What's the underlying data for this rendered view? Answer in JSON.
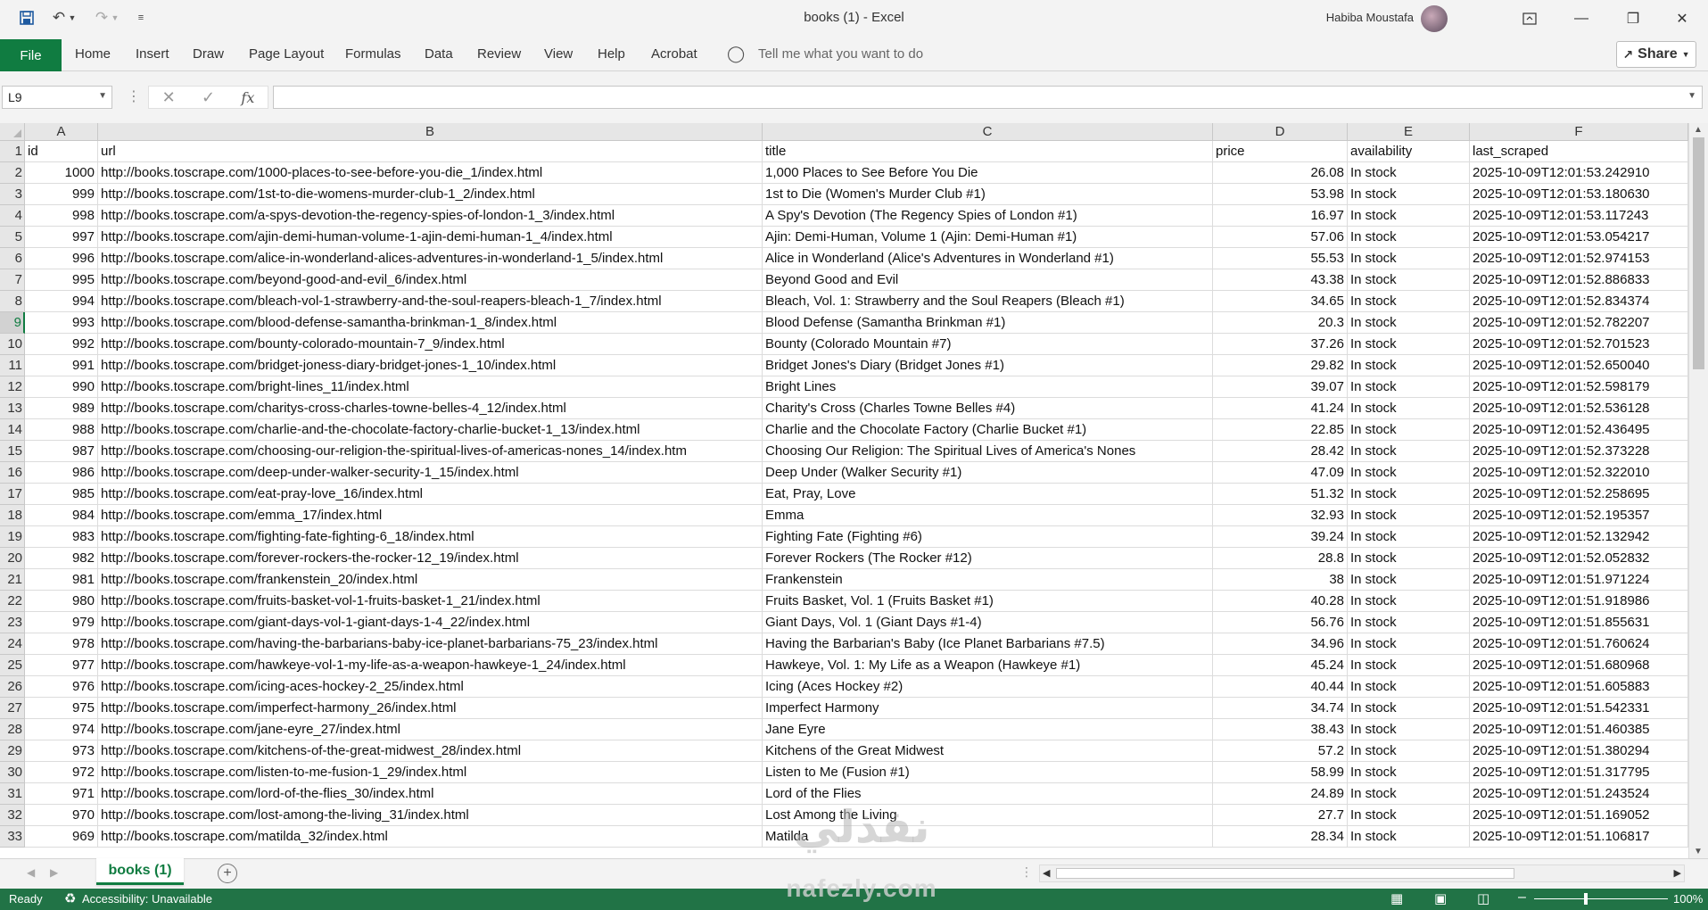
{
  "window": {
    "title": "books (1)  -  Excel",
    "user_name": "Habiba Moustafa"
  },
  "quick_access": {
    "save_icon": "save-icon",
    "undo_icon": "undo-icon",
    "redo_icon": "redo-icon",
    "customize_icon": "customize-icon"
  },
  "ribbon": {
    "file": "File",
    "tabs": [
      "Home",
      "Insert",
      "Draw",
      "Page Layout",
      "Formulas",
      "Data",
      "Review",
      "View",
      "Help",
      "Acrobat"
    ],
    "tell_me": "Tell me what you want to do",
    "share": "Share"
  },
  "formula_bar": {
    "name_box": "L9",
    "fx": "fx",
    "formula": ""
  },
  "grid": {
    "columns": [
      "A",
      "B",
      "C",
      "D",
      "E",
      "F"
    ],
    "selected_row": 9,
    "rows": [
      {
        "n": "1",
        "id": "id",
        "url": "url",
        "title": "title",
        "price": "price",
        "availability": "availability",
        "last_scraped": "last_scraped"
      },
      {
        "n": "2",
        "id": "1000",
        "url": "http://books.toscrape.com/1000-places-to-see-before-you-die_1/index.html",
        "title": "1,000 Places to See Before You Die",
        "price": "26.08",
        "availability": "In stock",
        "last_scraped": "2025-10-09T12:01:53.242910"
      },
      {
        "n": "3",
        "id": "999",
        "url": "http://books.toscrape.com/1st-to-die-womens-murder-club-1_2/index.html",
        "title": "1st to Die (Women's Murder Club #1)",
        "price": "53.98",
        "availability": "In stock",
        "last_scraped": "2025-10-09T12:01:53.180630"
      },
      {
        "n": "4",
        "id": "998",
        "url": "http://books.toscrape.com/a-spys-devotion-the-regency-spies-of-london-1_3/index.html",
        "title": "A Spy's Devotion (The Regency Spies of London #1)",
        "price": "16.97",
        "availability": "In stock",
        "last_scraped": "2025-10-09T12:01:53.117243"
      },
      {
        "n": "5",
        "id": "997",
        "url": "http://books.toscrape.com/ajin-demi-human-volume-1-ajin-demi-human-1_4/index.html",
        "title": "Ajin: Demi-Human, Volume 1 (Ajin: Demi-Human #1)",
        "price": "57.06",
        "availability": "In stock",
        "last_scraped": "2025-10-09T12:01:53.054217"
      },
      {
        "n": "6",
        "id": "996",
        "url": "http://books.toscrape.com/alice-in-wonderland-alices-adventures-in-wonderland-1_5/index.html",
        "title": "Alice in Wonderland (Alice's Adventures in Wonderland #1)",
        "price": "55.53",
        "availability": "In stock",
        "last_scraped": "2025-10-09T12:01:52.974153"
      },
      {
        "n": "7",
        "id": "995",
        "url": "http://books.toscrape.com/beyond-good-and-evil_6/index.html",
        "title": "Beyond Good and Evil",
        "price": "43.38",
        "availability": "In stock",
        "last_scraped": "2025-10-09T12:01:52.886833"
      },
      {
        "n": "8",
        "id": "994",
        "url": "http://books.toscrape.com/bleach-vol-1-strawberry-and-the-soul-reapers-bleach-1_7/index.html",
        "title": "Bleach, Vol. 1: Strawberry and the Soul Reapers (Bleach #1)",
        "price": "34.65",
        "availability": "In stock",
        "last_scraped": "2025-10-09T12:01:52.834374"
      },
      {
        "n": "9",
        "id": "993",
        "url": "http://books.toscrape.com/blood-defense-samantha-brinkman-1_8/index.html",
        "title": "Blood Defense (Samantha Brinkman #1)",
        "price": "20.3",
        "availability": "In stock",
        "last_scraped": "2025-10-09T12:01:52.782207"
      },
      {
        "n": "10",
        "id": "992",
        "url": "http://books.toscrape.com/bounty-colorado-mountain-7_9/index.html",
        "title": "Bounty (Colorado Mountain #7)",
        "price": "37.26",
        "availability": "In stock",
        "last_scraped": "2025-10-09T12:01:52.701523"
      },
      {
        "n": "11",
        "id": "991",
        "url": "http://books.toscrape.com/bridget-joness-diary-bridget-jones-1_10/index.html",
        "title": "Bridget Jones's Diary (Bridget Jones #1)",
        "price": "29.82",
        "availability": "In stock",
        "last_scraped": "2025-10-09T12:01:52.650040"
      },
      {
        "n": "12",
        "id": "990",
        "url": "http://books.toscrape.com/bright-lines_11/index.html",
        "title": "Bright Lines",
        "price": "39.07",
        "availability": "In stock",
        "last_scraped": "2025-10-09T12:01:52.598179"
      },
      {
        "n": "13",
        "id": "989",
        "url": "http://books.toscrape.com/charitys-cross-charles-towne-belles-4_12/index.html",
        "title": "Charity's Cross (Charles Towne Belles #4)",
        "price": "41.24",
        "availability": "In stock",
        "last_scraped": "2025-10-09T12:01:52.536128"
      },
      {
        "n": "14",
        "id": "988",
        "url": "http://books.toscrape.com/charlie-and-the-chocolate-factory-charlie-bucket-1_13/index.html",
        "title": "Charlie and the Chocolate Factory (Charlie Bucket #1)",
        "price": "22.85",
        "availability": "In stock",
        "last_scraped": "2025-10-09T12:01:52.436495"
      },
      {
        "n": "15",
        "id": "987",
        "url": "http://books.toscrape.com/choosing-our-religion-the-spiritual-lives-of-americas-nones_14/index.htm",
        "title": "Choosing Our Religion: The Spiritual Lives of America's Nones",
        "price": "28.42",
        "availability": "In stock",
        "last_scraped": "2025-10-09T12:01:52.373228"
      },
      {
        "n": "16",
        "id": "986",
        "url": "http://books.toscrape.com/deep-under-walker-security-1_15/index.html",
        "title": "Deep Under (Walker Security #1)",
        "price": "47.09",
        "availability": "In stock",
        "last_scraped": "2025-10-09T12:01:52.322010"
      },
      {
        "n": "17",
        "id": "985",
        "url": "http://books.toscrape.com/eat-pray-love_16/index.html",
        "title": "Eat, Pray, Love",
        "price": "51.32",
        "availability": "In stock",
        "last_scraped": "2025-10-09T12:01:52.258695"
      },
      {
        "n": "18",
        "id": "984",
        "url": "http://books.toscrape.com/emma_17/index.html",
        "title": "Emma",
        "price": "32.93",
        "availability": "In stock",
        "last_scraped": "2025-10-09T12:01:52.195357"
      },
      {
        "n": "19",
        "id": "983",
        "url": "http://books.toscrape.com/fighting-fate-fighting-6_18/index.html",
        "title": "Fighting Fate (Fighting #6)",
        "price": "39.24",
        "availability": "In stock",
        "last_scraped": "2025-10-09T12:01:52.132942"
      },
      {
        "n": "20",
        "id": "982",
        "url": "http://books.toscrape.com/forever-rockers-the-rocker-12_19/index.html",
        "title": "Forever Rockers (The Rocker #12)",
        "price": "28.8",
        "availability": "In stock",
        "last_scraped": "2025-10-09T12:01:52.052832"
      },
      {
        "n": "21",
        "id": "981",
        "url": "http://books.toscrape.com/frankenstein_20/index.html",
        "title": "Frankenstein",
        "price": "38",
        "availability": "In stock",
        "last_scraped": "2025-10-09T12:01:51.971224"
      },
      {
        "n": "22",
        "id": "980",
        "url": "http://books.toscrape.com/fruits-basket-vol-1-fruits-basket-1_21/index.html",
        "title": "Fruits Basket, Vol. 1 (Fruits Basket #1)",
        "price": "40.28",
        "availability": "In stock",
        "last_scraped": "2025-10-09T12:01:51.918986"
      },
      {
        "n": "23",
        "id": "979",
        "url": "http://books.toscrape.com/giant-days-vol-1-giant-days-1-4_22/index.html",
        "title": "Giant Days, Vol. 1 (Giant Days #1-4)",
        "price": "56.76",
        "availability": "In stock",
        "last_scraped": "2025-10-09T12:01:51.855631"
      },
      {
        "n": "24",
        "id": "978",
        "url": "http://books.toscrape.com/having-the-barbarians-baby-ice-planet-barbarians-75_23/index.html",
        "title": "Having the Barbarian's Baby (Ice Planet Barbarians #7.5)",
        "price": "34.96",
        "availability": "In stock",
        "last_scraped": "2025-10-09T12:01:51.760624"
      },
      {
        "n": "25",
        "id": "977",
        "url": "http://books.toscrape.com/hawkeye-vol-1-my-life-as-a-weapon-hawkeye-1_24/index.html",
        "title": "Hawkeye, Vol. 1: My Life as a Weapon (Hawkeye #1)",
        "price": "45.24",
        "availability": "In stock",
        "last_scraped": "2025-10-09T12:01:51.680968"
      },
      {
        "n": "26",
        "id": "976",
        "url": "http://books.toscrape.com/icing-aces-hockey-2_25/index.html",
        "title": "Icing (Aces Hockey #2)",
        "price": "40.44",
        "availability": "In stock",
        "last_scraped": "2025-10-09T12:01:51.605883"
      },
      {
        "n": "27",
        "id": "975",
        "url": "http://books.toscrape.com/imperfect-harmony_26/index.html",
        "title": "Imperfect Harmony",
        "price": "34.74",
        "availability": "In stock",
        "last_scraped": "2025-10-09T12:01:51.542331"
      },
      {
        "n": "28",
        "id": "974",
        "url": "http://books.toscrape.com/jane-eyre_27/index.html",
        "title": "Jane Eyre",
        "price": "38.43",
        "availability": "In stock",
        "last_scraped": "2025-10-09T12:01:51.460385"
      },
      {
        "n": "29",
        "id": "973",
        "url": "http://books.toscrape.com/kitchens-of-the-great-midwest_28/index.html",
        "title": "Kitchens of the Great Midwest",
        "price": "57.2",
        "availability": "In stock",
        "last_scraped": "2025-10-09T12:01:51.380294"
      },
      {
        "n": "30",
        "id": "972",
        "url": "http://books.toscrape.com/listen-to-me-fusion-1_29/index.html",
        "title": "Listen to Me (Fusion #1)",
        "price": "58.99",
        "availability": "In stock",
        "last_scraped": "2025-10-09T12:01:51.317795"
      },
      {
        "n": "31",
        "id": "971",
        "url": "http://books.toscrape.com/lord-of-the-flies_30/index.html",
        "title": "Lord of the Flies",
        "price": "24.89",
        "availability": "In stock",
        "last_scraped": "2025-10-09T12:01:51.243524"
      },
      {
        "n": "32",
        "id": "970",
        "url": "http://books.toscrape.com/lost-among-the-living_31/index.html",
        "title": "Lost Among the Living",
        "price": "27.7",
        "availability": "In stock",
        "last_scraped": "2025-10-09T12:01:51.169052"
      },
      {
        "n": "33",
        "id": "969",
        "url": "http://books.toscrape.com/matilda_32/index.html",
        "title": "Matilda",
        "price": "28.34",
        "availability": "In stock",
        "last_scraped": "2025-10-09T12:01:51.106817"
      }
    ]
  },
  "sheet_tabs": {
    "active": "books (1)"
  },
  "status_bar": {
    "ready": "Ready",
    "accessibility": "Accessibility: Unavailable",
    "zoom": "100%",
    "zoom_percent": 100
  },
  "watermark": {
    "arabic": "نفذلي",
    "latin": "nafezly.com"
  }
}
